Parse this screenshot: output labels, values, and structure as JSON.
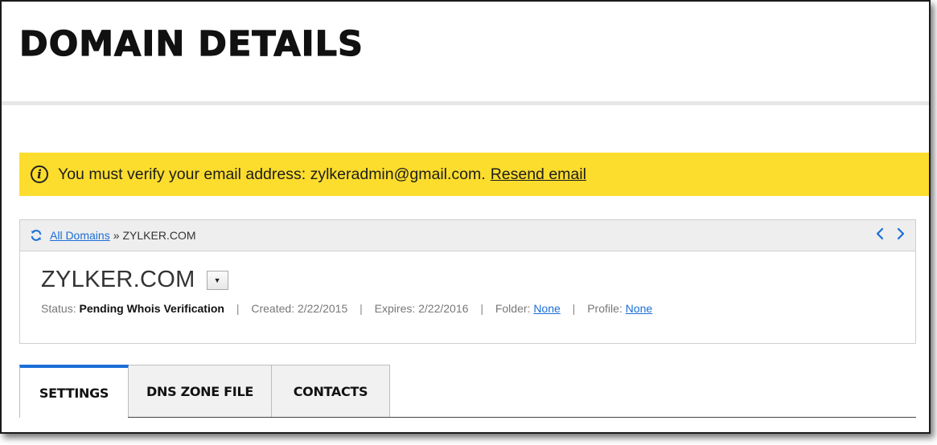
{
  "page": {
    "title": "DOMAIN DETAILS"
  },
  "alert": {
    "icon": "info-icon",
    "message": "You must verify your email address: zylkeradmin@gmail.com.",
    "link_label": "Resend email",
    "background": "#fcdd2d"
  },
  "breadcrumb": {
    "refresh_icon": "refresh-icon",
    "link_label": "All Domains",
    "separator": "»",
    "current": "ZYLKER.COM",
    "prev_icon": "chevron-left-icon",
    "next_icon": "chevron-right-icon"
  },
  "domain": {
    "name": "ZYLKER.COM",
    "dropdown_icon": "caret-down-icon",
    "status_label": "Status:",
    "status_value": "Pending Whois Verification",
    "created": "Created: 2/22/2015",
    "expires": "Expires: 2/22/2016",
    "folder_label": "Folder:",
    "folder_value": "None",
    "profile_label": "Profile:",
    "profile_value": "None",
    "separator": "|"
  },
  "tabs": [
    {
      "label": "SETTINGS",
      "active": true
    },
    {
      "label": "DNS ZONE FILE",
      "active": false
    },
    {
      "label": "CONTACTS",
      "active": false
    }
  ],
  "colors": {
    "link": "#1a6ed8",
    "accent": "#1a6ed8",
    "alert": "#fcdd2d"
  }
}
